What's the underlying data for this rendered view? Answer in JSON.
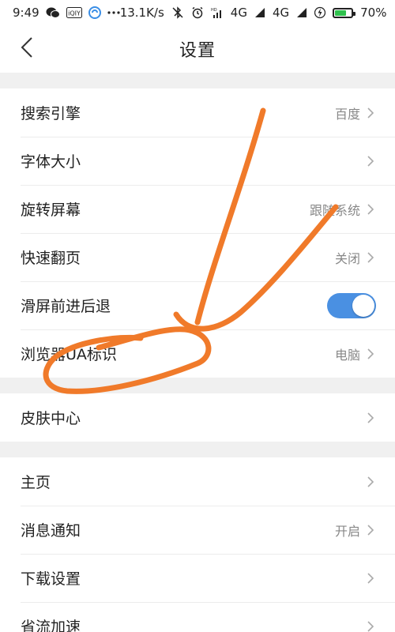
{
  "status_bar": {
    "time": "9:49",
    "net_speed": "13.1K/s",
    "signal_1": "4G",
    "signal_2": "4G",
    "battery": "70%",
    "battery_level": 0.7
  },
  "header": {
    "title": "设置"
  },
  "groups": [
    {
      "rows": [
        {
          "label": "搜索引擎",
          "value": "百度"
        },
        {
          "label": "字体大小",
          "value": ""
        },
        {
          "label": "旋转屏幕",
          "value": "跟随系统"
        },
        {
          "label": "快速翻页",
          "value": "关闭"
        },
        {
          "label": "滑屏前进后退",
          "toggle_on": true
        },
        {
          "label": "浏览器UA标识",
          "value": "电脑"
        }
      ]
    },
    {
      "rows": [
        {
          "label": "皮肤中心",
          "value": ""
        }
      ]
    },
    {
      "rows": [
        {
          "label": "主页",
          "value": ""
        },
        {
          "label": "消息通知",
          "value": "开启"
        },
        {
          "label": "下载设置",
          "value": ""
        },
        {
          "label": "省流加速",
          "value": ""
        }
      ]
    }
  ],
  "colors": {
    "accent": "#4a90e2",
    "annotation": "#f07a2a",
    "battery_fill": "#2fc14d"
  },
  "icons": [
    "back-chevron-icon",
    "chevron-right-icon",
    "wechat-icon",
    "iqiyi-icon",
    "alarm-icon",
    "battery-icon"
  ]
}
